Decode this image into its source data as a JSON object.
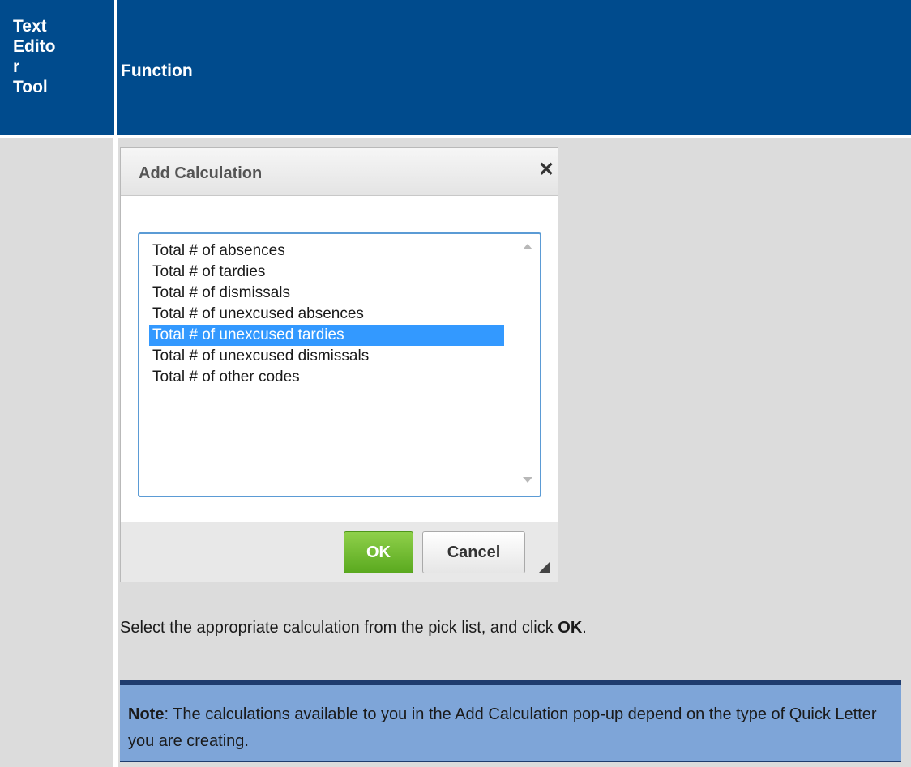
{
  "header": {
    "col1_lines": [
      "Text",
      "Edito",
      "r",
      "Tool"
    ],
    "col2": "Function"
  },
  "dialog": {
    "title": "Add Calculation",
    "close_glyph": "✕",
    "options": [
      "Total # of absences",
      "Total # of tardies",
      "Total # of dismissals",
      "Total # of unexcused absences",
      "Total # of unexcused tardies",
      "Total # of unexcused dismissals",
      "Total # of other codes"
    ],
    "selected_option": "Total # of unexcused tardies",
    "ok_label": "OK",
    "cancel_label": "Cancel"
  },
  "instruction": {
    "before": "Select the appropriate calculation from the pick list, and click ",
    "bold": "OK",
    "after": "."
  },
  "note": {
    "label": "Note",
    "text": ": The calculations available to you in the Add Calculation pop-up depend on the type of Quick Letter you are creating."
  },
  "colors": {
    "header_bg": "#004b8d",
    "cell_bg": "#dcdcdc",
    "selection": "#3399ff",
    "ok_green": "#5aa91f",
    "note_bg": "#7ea5d8",
    "note_border": "#1f3c6e"
  }
}
